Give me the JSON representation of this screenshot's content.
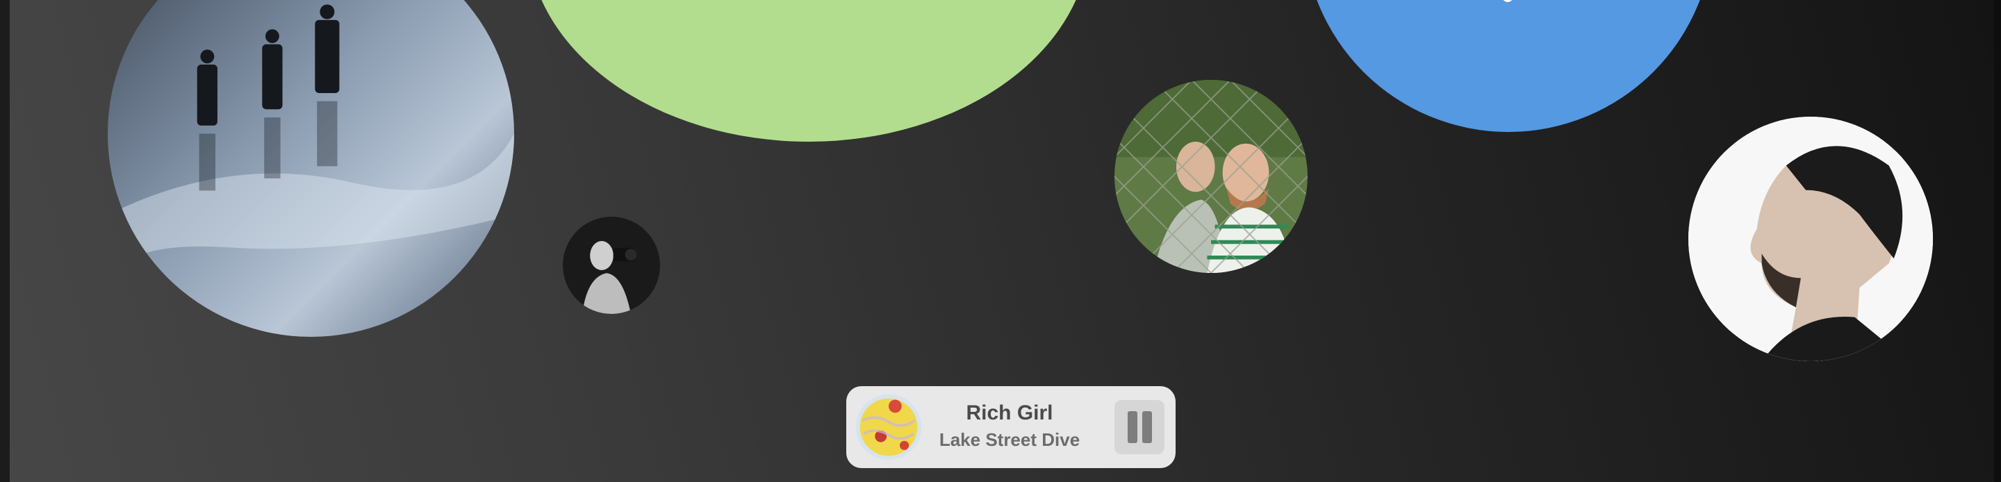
{
  "now_playing": {
    "title": "Rich Girl",
    "artist": "Lake Street Dive",
    "state": "playing",
    "control_icon": "pause-icon"
  },
  "bubbles": [
    {
      "kind": "artist-photo",
      "subject": "band-on-wet-ground"
    },
    {
      "kind": "artist-photo",
      "subject": "photographer-black-and-white"
    },
    {
      "kind": "color-placeholder",
      "color": "#b2dd8e"
    },
    {
      "kind": "artist-photo",
      "subject": "duo-behind-chain-fence"
    },
    {
      "kind": "color-placeholder",
      "color": "#5499e2"
    },
    {
      "kind": "artist-photo",
      "subject": "man-profile-black-and-white"
    }
  ],
  "colors": {
    "background_light": "#474747",
    "background_dark": "#141414",
    "player_bg": "#e8e8e8",
    "green_bubble": "#b2dd8e",
    "blue_bubble": "#5499e2"
  }
}
